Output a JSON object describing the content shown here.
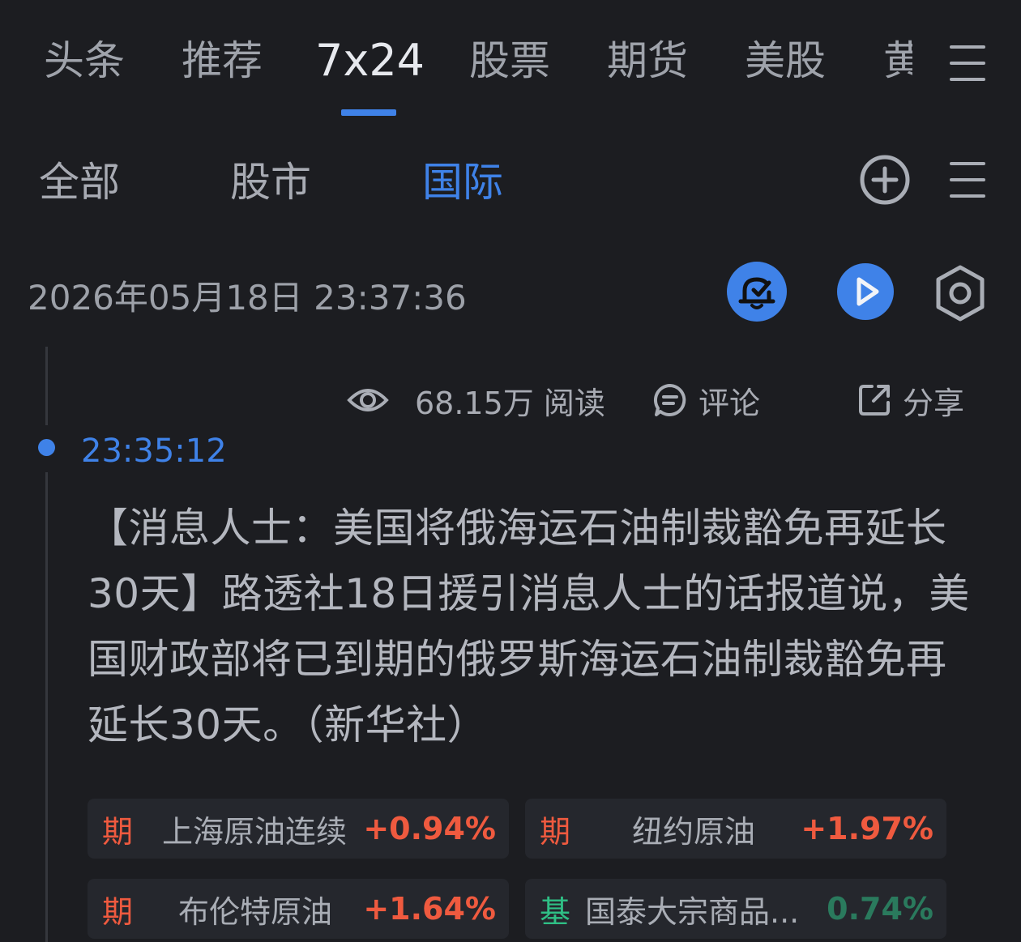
{
  "top_tabs": [
    "头条",
    "推荐",
    "7x24",
    "股票",
    "期货",
    "美股",
    "黄"
  ],
  "active_top_tab": "7x24",
  "sub_tabs": [
    "全部",
    "股市",
    "国际"
  ],
  "active_sub_tab": "国际",
  "date_header": "2026年05月18日 23:37:36",
  "icons": {
    "menu": "menu-icon",
    "add": "plus-circle-icon",
    "alert": "bell-check-icon",
    "play": "play-icon",
    "settings": "hexagon-settings-icon",
    "views": "eye-icon",
    "comment": "comment-icon",
    "share": "share-icon"
  },
  "news": {
    "views": "68.15万 阅读",
    "comment_label": "评论",
    "share_label": "分享",
    "time": "23:35:12",
    "content": "【消息人士：美国将俄海运石油制裁豁免再延长30天】路透社18日援引消息人士的话报道说，美国财政部将已到期的俄罗斯海运石油制裁豁免再延长30天。（新华社）"
  },
  "related": [
    {
      "kind": "期",
      "name": "上海原油连续",
      "change": "+0.94%"
    },
    {
      "kind": "期",
      "name": "纽约原油",
      "change": "+1.97%"
    },
    {
      "kind": "期",
      "name": "布伦特原油",
      "change": "+1.64%"
    },
    {
      "kind": "基",
      "name": "国泰大宗商品...",
      "change": "0.74%"
    }
  ],
  "colors": {
    "background": "#1c1d21",
    "accent": "#3f82e8",
    "up": "#ef5a3f",
    "fund": "#2fbf85"
  }
}
